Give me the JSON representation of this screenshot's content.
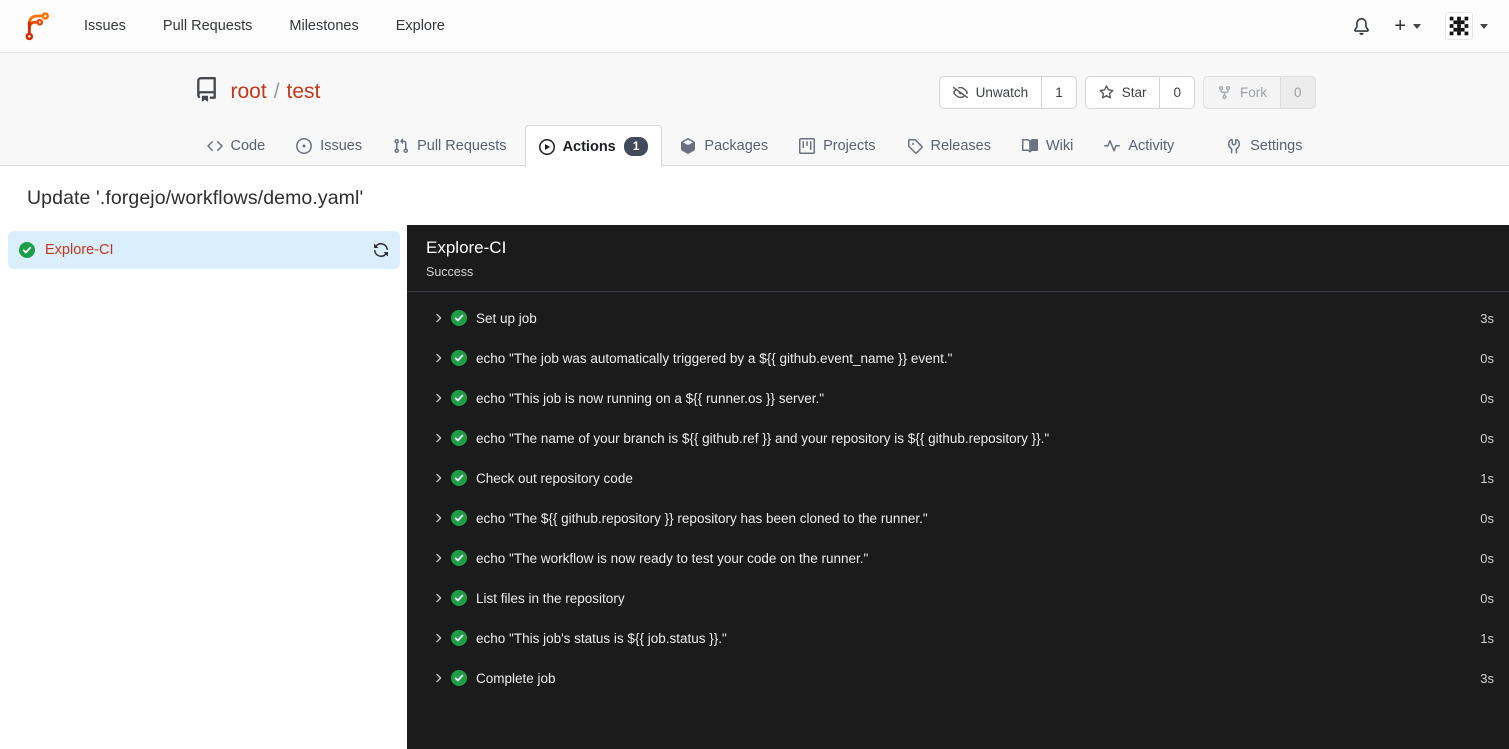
{
  "navbar": {
    "items": [
      {
        "label": "Issues"
      },
      {
        "label": "Pull Requests"
      },
      {
        "label": "Milestones"
      },
      {
        "label": "Explore"
      }
    ],
    "new_label": "+"
  },
  "repo": {
    "owner": "root",
    "separator": "/",
    "name": "test",
    "buttons": [
      {
        "label": "Unwatch",
        "count": "1"
      },
      {
        "label": "Star",
        "count": "0"
      },
      {
        "label": "Fork",
        "count": "0",
        "disabled": true
      }
    ]
  },
  "tabs": [
    {
      "label": "Code"
    },
    {
      "label": "Issues"
    },
    {
      "label": "Pull Requests"
    },
    {
      "label": "Actions",
      "badge": "1",
      "active": true
    },
    {
      "label": "Packages"
    },
    {
      "label": "Projects"
    },
    {
      "label": "Releases"
    },
    {
      "label": "Wiki"
    },
    {
      "label": "Activity"
    },
    {
      "label": "Settings"
    }
  ],
  "page": {
    "title": "Update '.forgejo/workflows/demo.yaml'"
  },
  "jobs_sidebar": [
    {
      "name": "Explore-CI",
      "status": "success"
    }
  ],
  "job_panel": {
    "title": "Explore-CI",
    "status": "Success",
    "steps": [
      {
        "name": "Set up job",
        "duration": "3s"
      },
      {
        "name": "echo \"The job was automatically triggered by a ${{ github.event_name }} event.\"",
        "duration": "0s"
      },
      {
        "name": "echo \"This job is now running on a ${{ runner.os }} server.\"",
        "duration": "0s"
      },
      {
        "name": "echo \"The name of your branch is ${{ github.ref }} and your repository is ${{ github.repository }}.\"",
        "duration": "0s"
      },
      {
        "name": "Check out repository code",
        "duration": "1s"
      },
      {
        "name": "echo \"The ${{ github.repository }} repository has been cloned to the runner.\"",
        "duration": "0s"
      },
      {
        "name": "echo \"The workflow is now ready to test your code on the runner.\"",
        "duration": "0s"
      },
      {
        "name": "List files in the repository",
        "duration": "0s"
      },
      {
        "name": "echo \"This job's status is ${{ job.status }}.\"",
        "duration": "1s"
      },
      {
        "name": "Complete job",
        "duration": "3s"
      }
    ]
  },
  "colors": {
    "primary_link": "#c3391b",
    "success_green": "#1f9e49",
    "tab_badge_bg": "#404a5a",
    "selected_job_bg": "#dbeefb",
    "panel_bg": "#1b1b1b",
    "header_bg": "#f8f8f8"
  }
}
